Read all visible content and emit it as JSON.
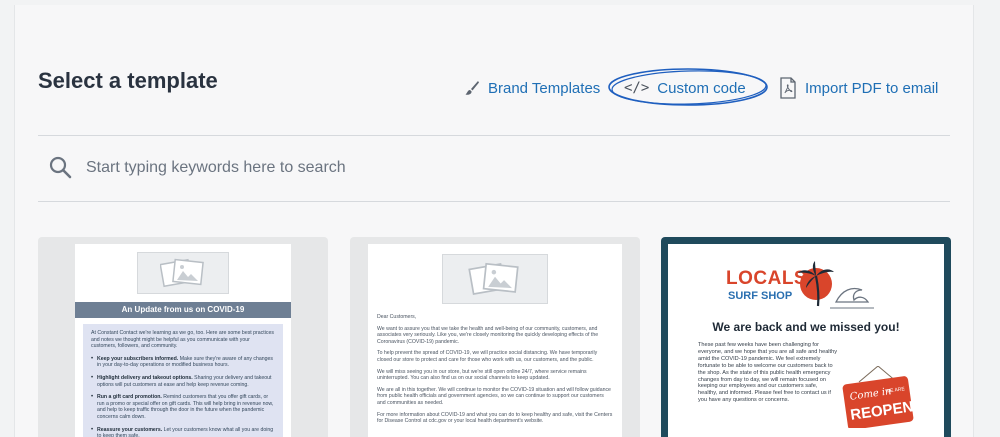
{
  "page": {
    "title": "Select a template"
  },
  "toolbar": {
    "brand_label": "Brand Templates",
    "custom_label": "Custom code",
    "custom_icon_text": "</>",
    "import_label": "Import PDF to email"
  },
  "search": {
    "placeholder": "Start typing keywords here to search"
  },
  "icons": {
    "brand": "paintbrush-icon",
    "custom": "code-icon",
    "import": "pdf-file-icon",
    "search": "search-icon"
  },
  "colors": {
    "accent": "#1f6fb5",
    "title": "#2a3340",
    "card3_frame": "#1f4a5c",
    "banner": "#6e7f94"
  },
  "templates": [
    {
      "banner": "An Update from us on COVID-19",
      "intro": "At Constant Contact we're learning as we go, too. Here are some best practices and notes we thought might be helpful as you communicate with your customers, followers, and community.",
      "bullets": [
        {
          "title": "Keep your subscribers informed.",
          "text": " Make sure they're aware of any changes in your day-to-day operations or modified business hours."
        },
        {
          "title": "Highlight delivery and takeout options.",
          "text": " Sharing your delivery and takeout options will put customers at ease and help keep revenue coming."
        },
        {
          "title": "Run a gift card promotion.",
          "text": " Remind customers that you offer gift cards, or run a promo or special offer on gift cards. This will help bring in revenue now, and help to keep traffic through the door in the future when the pandemic concerns calm down."
        },
        {
          "title": "Reassure your customers.",
          "text": " Let your customers know what all you are doing to keep them safe."
        }
      ]
    },
    {
      "paragraphs": [
        "Dear Customers,",
        "We want to assure you that we take the health and well-being of our community, customers, and associates very seriously. Like you, we're closely monitoring the quickly developing effects of the Coronavirus (COVID-19) pandemic.",
        "To help prevent the spread of COVID-19, we will practice social distancing. We have temporarily closed our store to protect and care for those who work with us, our customers, and the public.",
        "We will miss seeing you in our store, but we're still open online 24/7, where service remains uninterrupted. You can also find us on our social channels to keep updated.",
        "We are all in this together. We will continue to monitor the COVID-19 situation and will follow guidance from public health officials and government agencies, so we can continue to support our customers and communities as needed.",
        "For more information about COVID-19 and what you can do to keep healthy and safe, visit the Centers for Disease Control at cdc.gov or your local health department's website."
      ]
    },
    {
      "logo_top": "LOCALS",
      "logo_bottom": "SURF SHOP",
      "heading": "We are back and we missed you!",
      "body": "These past few weeks have been challenging for everyone, and we hope that you are all safe and healthy amid the COVID-19 pandemic. We feel extremely fortunate to be able to welcome our customers back to the shop. As the state of this public health emergency changes from day to day, we will remain focused on keeping our employees and our customers safe, healthy, and informed. Please feel free to contact us if you have any questions or concerns.",
      "sign_script": "Come in",
      "sign_small": "WE ARE",
      "sign_main": "REOPEN"
    }
  ]
}
